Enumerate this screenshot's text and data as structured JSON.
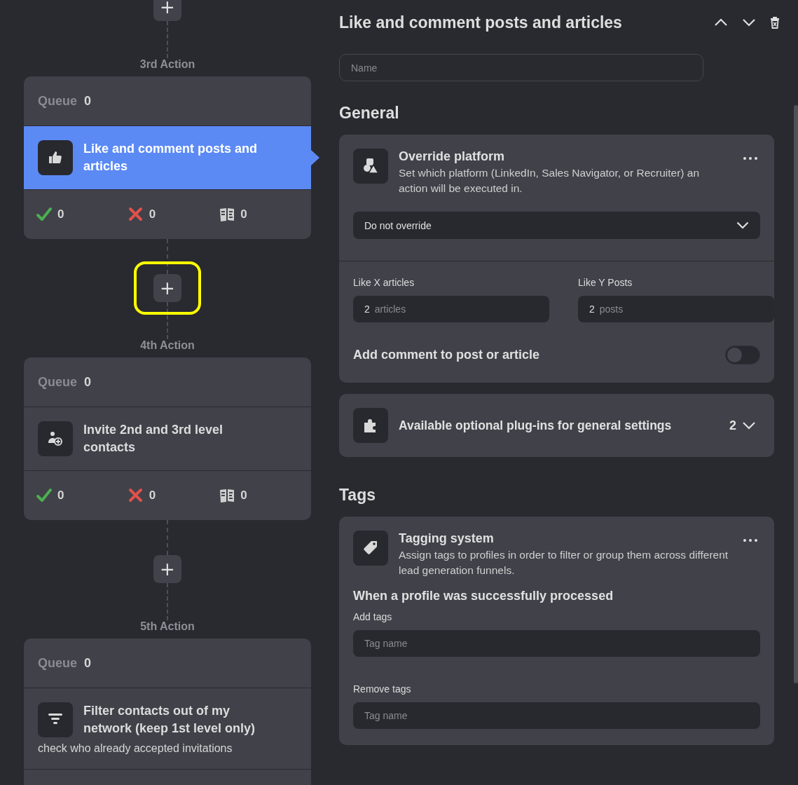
{
  "steps": [
    {
      "add_button": {
        "label": "+",
        "highlighted": false
      },
      "step_label": "3rd Action",
      "queue_label": "Queue",
      "queue_count": "0",
      "kind": "like",
      "title": "Like and comment posts and articles",
      "selected": true,
      "stats": [
        {
          "kind": "success",
          "value": "0"
        },
        {
          "kind": "failed",
          "value": "0"
        },
        {
          "kind": "skipped",
          "value": "0"
        }
      ]
    },
    {
      "add_button": {
        "label": "+",
        "highlighted": true
      },
      "step_label": "4th Action",
      "queue_label": "Queue",
      "queue_count": "0",
      "kind": "invite",
      "title": "Invite 2nd and 3rd level contacts",
      "selected": false,
      "stats": [
        {
          "kind": "success",
          "value": "0"
        },
        {
          "kind": "failed",
          "value": "0"
        },
        {
          "kind": "skipped",
          "value": "0"
        }
      ]
    },
    {
      "add_button": {
        "label": "+",
        "highlighted": false
      },
      "step_label": "5th Action",
      "queue_label": "Queue",
      "queue_count": "0",
      "kind": "filter",
      "title": "Filter contacts out of my network (keep 1st level only)",
      "description": "check who already accepted invitations",
      "selected": false
    }
  ],
  "panel": {
    "title": "Like and comment posts and articles",
    "name_field": {
      "placeholder": "Name"
    },
    "general": {
      "heading": "General",
      "override": {
        "title": "Override platform",
        "description": "Set which platform (LinkedIn, Sales Navigator, or Recruiter) an action will be executed in.",
        "select": {
          "value": "Do not override"
        },
        "fields": [
          {
            "label": "Like X articles",
            "value": "2",
            "unit": "articles"
          },
          {
            "label": "Like Y Posts",
            "value": "2",
            "unit": "posts"
          }
        ],
        "toggle": {
          "label": "Add comment to post or article",
          "on": false
        }
      },
      "plugins": {
        "title": "Available optional plug-ins for general settings",
        "count": "2",
        "expanded": false
      }
    },
    "tags": {
      "heading": "Tags",
      "title": "Tagging system",
      "description": "Assign tags to profiles in order to filter or group them across different lead generation funnels.",
      "subheading": "When a profile was successfully processed",
      "fields": [
        {
          "label": "Add tags",
          "placeholder": "Tag name"
        },
        {
          "label": "Remove tags",
          "placeholder": "Tag name"
        }
      ]
    }
  }
}
